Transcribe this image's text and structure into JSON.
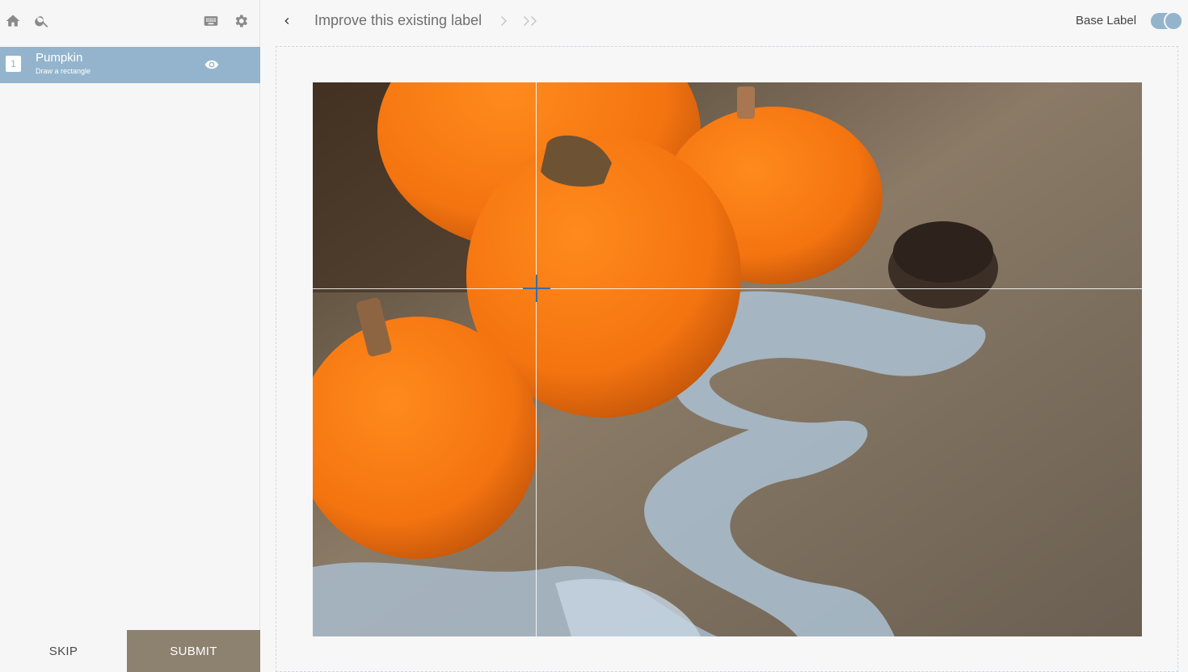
{
  "sidebar": {
    "toolbar": {
      "home": "home-icon",
      "search": "search-icon",
      "keyboard": "keyboard-icon",
      "settings": "gear-icon"
    },
    "labels": [
      {
        "number": "1",
        "name": "Pumpkin",
        "instruction": "Draw a rectangle",
        "visibility_icon": "eye-icon"
      }
    ],
    "skip_label": "SKIP",
    "submit_label": "SUBMIT"
  },
  "header": {
    "title": "Improve this existing label",
    "base_label": "Base Label",
    "base_label_enabled": true
  },
  "colors": {
    "accent": "#93b4cc",
    "submit": "#8d8170"
  }
}
